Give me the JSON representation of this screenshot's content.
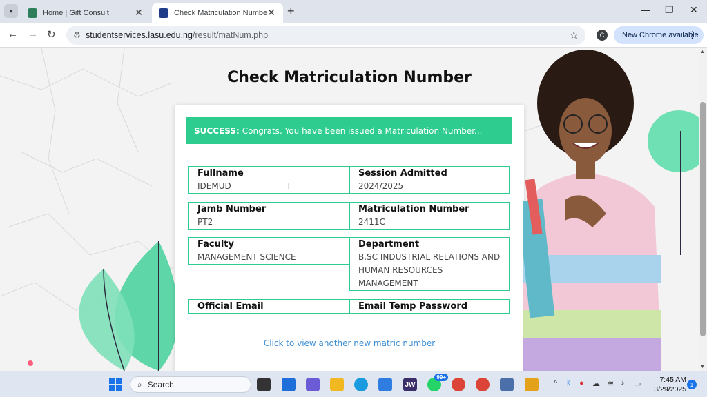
{
  "browser": {
    "tabs": [
      {
        "title": "Home | Gift Consult",
        "active": false
      },
      {
        "title": "Check Matriculation Number :: L",
        "active": true
      }
    ],
    "address": {
      "host": "studentservices.lasu.edu.ng",
      "path": "/result/matNum.php"
    },
    "profile_initial": "C",
    "update_label": "New Chrome available"
  },
  "page": {
    "title": "Check Matriculation Number",
    "alert": {
      "strong": "SUCCESS:",
      "text": "Congrats. You have been issued a Matriculation Number..."
    },
    "fields": {
      "fullname": {
        "label": "Fullname",
        "value_start": "IDEMUD",
        "value_end": "T"
      },
      "session": {
        "label": "Session Admitted",
        "value": "2024/2025"
      },
      "jamb": {
        "label": "Jamb Number",
        "value": "PT2"
      },
      "matric": {
        "label": "Matriculation Number",
        "value": "2411C"
      },
      "faculty": {
        "label": "Faculty",
        "value": "MANAGEMENT SCIENCE"
      },
      "department": {
        "label": "Department",
        "value": "B.SC INDUSTRIAL RELATIONS AND HUMAN RESOURCES MANAGEMENT"
      },
      "email": {
        "label": "Official Email",
        "value": ""
      },
      "password": {
        "label": "Email Temp Password",
        "value": ""
      }
    },
    "link_text": "Click to view another new matric number"
  },
  "taskbar": {
    "search_placeholder": "Search",
    "whatsapp_badge": "99+",
    "time": "7:45 AM",
    "date": "3/29/2025",
    "notification_count": "1"
  },
  "colors": {
    "accent_green": "#2ecc8f",
    "link_blue": "#3d8fd6"
  }
}
